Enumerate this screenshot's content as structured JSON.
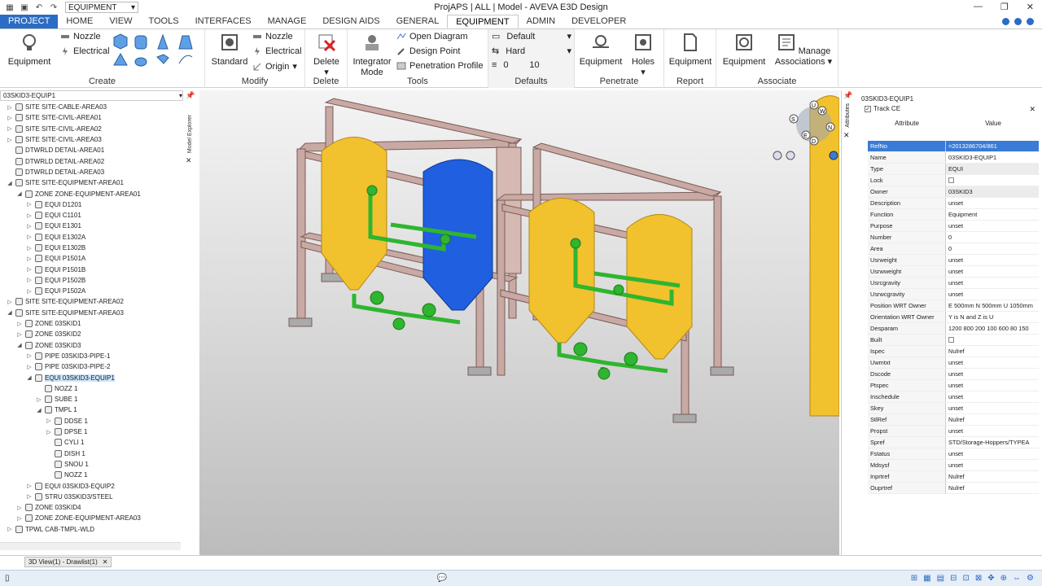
{
  "titlebar": {
    "combo_value": "EQUIPMENT",
    "title": "ProjAPS | ALL | Model - AVEVA E3D Design"
  },
  "tabs": [
    "PROJECT",
    "HOME",
    "VIEW",
    "TOOLS",
    "INTERFACES",
    "MANAGE",
    "DESIGN AIDS",
    "GENERAL",
    "EQUIPMENT",
    "ADMIN",
    "DEVELOPER"
  ],
  "ribbon": {
    "create": {
      "label": "Create",
      "equipment": "Equipment",
      "nozzle": "Nozzle",
      "electrical": "Electrical"
    },
    "modify": {
      "label": "Modify",
      "standard": "Standard",
      "nozzle": "Nozzle",
      "electrical": "Electrical",
      "origin": "Origin"
    },
    "delete": {
      "label": "Delete",
      "delete": "Delete"
    },
    "tools": {
      "label": "Tools",
      "integrator": "Integrator",
      "mode": "Mode",
      "open_diagram": "Open Diagram",
      "design_point": "Design Point",
      "penetration_profile": "Penetration Profile"
    },
    "defaults": {
      "label": "Defaults",
      "default": "Default",
      "hard": "Hard",
      "val1": "0",
      "val2": "10"
    },
    "penetrate": {
      "label": "Penetrate",
      "equipment": "Equipment",
      "holes": "Holes"
    },
    "report": {
      "label": "Report",
      "equipment": "Equipment"
    },
    "associate": {
      "label": "Associate",
      "equipment": "Equipment",
      "manage": "Manage",
      "associations": "Associations"
    }
  },
  "tree": {
    "selector": "03SKID3-EQUIP1",
    "side_label": "Model Explorer",
    "rows": [
      {
        "d": 1,
        "t": "+",
        "l": "SITE SITE-CABLE-AREA03"
      },
      {
        "d": 1,
        "t": "+",
        "l": "SITE SITE-CIVIL-AREA01"
      },
      {
        "d": 1,
        "t": "+",
        "l": "SITE SITE-CIVIL-AREA02"
      },
      {
        "d": 1,
        "t": "+",
        "l": "SITE SITE-CIVIL-AREA03"
      },
      {
        "d": 1,
        "t": "",
        "l": "DTWRLD DETAIL-AREA01"
      },
      {
        "d": 1,
        "t": "",
        "l": "DTWRLD DETAIL-AREA02"
      },
      {
        "d": 1,
        "t": "",
        "l": "DTWRLD DETAIL-AREA03"
      },
      {
        "d": 1,
        "t": "-",
        "l": "SITE SITE-EQUIPMENT-AREA01"
      },
      {
        "d": 2,
        "t": "-",
        "l": "ZONE ZONE-EQUIPMENT-AREA01"
      },
      {
        "d": 3,
        "t": "+",
        "l": "EQUI D1201"
      },
      {
        "d": 3,
        "t": "+",
        "l": "EQUI C1101"
      },
      {
        "d": 3,
        "t": "+",
        "l": "EQUI E1301"
      },
      {
        "d": 3,
        "t": "+",
        "l": "EQUI E1302A"
      },
      {
        "d": 3,
        "t": "+",
        "l": "EQUI E1302B"
      },
      {
        "d": 3,
        "t": "+",
        "l": "EQUI P1501A"
      },
      {
        "d": 3,
        "t": "+",
        "l": "EQUI P1501B"
      },
      {
        "d": 3,
        "t": "+",
        "l": "EQUI P1502B"
      },
      {
        "d": 3,
        "t": "+",
        "l": "EQUI P1502A"
      },
      {
        "d": 1,
        "t": "+",
        "l": "SITE SITE-EQUIPMENT-AREA02"
      },
      {
        "d": 1,
        "t": "-",
        "l": "SITE SITE-EQUIPMENT-AREA03"
      },
      {
        "d": 2,
        "t": "+",
        "l": "ZONE 03SKID1"
      },
      {
        "d": 2,
        "t": "+",
        "l": "ZONE 03SKID2"
      },
      {
        "d": 2,
        "t": "-",
        "l": "ZONE 03SKID3"
      },
      {
        "d": 3,
        "t": "+",
        "l": "PIPE 03SKID3-PIPE-1"
      },
      {
        "d": 3,
        "t": "+",
        "l": "PIPE 03SKID3-PIPE-2"
      },
      {
        "d": 3,
        "t": "-",
        "l": "EQUI 03SKID3-EQUIP1",
        "sel": true
      },
      {
        "d": 4,
        "t": "",
        "l": "NOZZ 1"
      },
      {
        "d": 4,
        "t": "+",
        "l": "SUBE 1"
      },
      {
        "d": 4,
        "t": "-",
        "l": "TMPL 1"
      },
      {
        "d": 5,
        "t": "+",
        "l": "DDSE 1"
      },
      {
        "d": 5,
        "t": "+",
        "l": "DPSE 1"
      },
      {
        "d": 5,
        "t": "",
        "l": "CYLI 1"
      },
      {
        "d": 5,
        "t": "",
        "l": "DISH 1"
      },
      {
        "d": 5,
        "t": "",
        "l": "SNOU 1"
      },
      {
        "d": 5,
        "t": "",
        "l": "NOZZ 1"
      },
      {
        "d": 3,
        "t": "+",
        "l": "EQUI 03SKID3-EQUIP2"
      },
      {
        "d": 3,
        "t": "+",
        "l": "STRU 03SKID3/STEEL"
      },
      {
        "d": 2,
        "t": "+",
        "l": "ZONE 03SKID4"
      },
      {
        "d": 2,
        "t": "+",
        "l": "ZONE ZONE-EQUIPMENT-AREA03"
      },
      {
        "d": 1,
        "t": "+",
        "l": "TPWL CAB-TMPL-WLD"
      }
    ]
  },
  "view_tab": {
    "label": "3D View(1) - Drawlist(1)",
    "close": "✕"
  },
  "attributes": {
    "title": "03SKID3-EQUIP1",
    "track_ce": "Track CE",
    "side_label": "Attributes",
    "col_attr": "Attribute",
    "col_value": "Value",
    "rows": [
      {
        "k": "RefNo",
        "v": "=2013286704/861",
        "sel": true
      },
      {
        "k": "Name",
        "v": "03SKID3-EQUIP1"
      },
      {
        "k": "Type",
        "v": "EQUI",
        "grey": true
      },
      {
        "k": "Lock",
        "v": "",
        "cb": true
      },
      {
        "k": "Owner",
        "v": "03SKID3",
        "grey": true
      },
      {
        "k": "Description",
        "v": "unset"
      },
      {
        "k": "Function",
        "v": "Equipment"
      },
      {
        "k": "Purpose",
        "v": "unset"
      },
      {
        "k": "Number",
        "v": "0"
      },
      {
        "k": "Area",
        "v": "0"
      },
      {
        "k": "Usrweight",
        "v": "unset"
      },
      {
        "k": "Usrwweight",
        "v": "unset"
      },
      {
        "k": "Usrcgravity",
        "v": "unset"
      },
      {
        "k": "Usrwcgravity",
        "v": "unset"
      },
      {
        "k": "Position WRT Owner",
        "v": "E 500mm N 500mm U 1050mm"
      },
      {
        "k": "Orientation WRT Owner",
        "v": "Y is N and Z is U"
      },
      {
        "k": "Desparam",
        "v": "1200 800 200 100 600 80 150"
      },
      {
        "k": "Built",
        "v": "",
        "cb": true
      },
      {
        "k": "Ispec",
        "v": "Nulref"
      },
      {
        "k": "Uwmtxt",
        "v": "unset"
      },
      {
        "k": "Dscode",
        "v": "unset"
      },
      {
        "k": "Ptspec",
        "v": "unset"
      },
      {
        "k": "Inschedule",
        "v": "unset"
      },
      {
        "k": "Skey",
        "v": "unset"
      },
      {
        "k": "StlRef",
        "v": "Nulref"
      },
      {
        "k": "Propst",
        "v": "unset"
      },
      {
        "k": "Spref",
        "v": "STD/Storage-Hoppers/TYPEA"
      },
      {
        "k": "Fstatus",
        "v": "unset"
      },
      {
        "k": "Mdsysf",
        "v": "unset"
      },
      {
        "k": "Inprtref",
        "v": "Nulref"
      },
      {
        "k": "Ouprtref",
        "v": "Nulref"
      }
    ]
  },
  "navcube": {
    "u": "U",
    "w": "W",
    "n": "N",
    "s": "S",
    "e": "E",
    "d": "D"
  },
  "colors": {
    "accent": "#2b6cc4",
    "vessel_yellow": "#f2c12e",
    "vessel_blue": "#1f5fe0",
    "pipe_green": "#2fb52f",
    "frame": "#c9a9a3"
  }
}
